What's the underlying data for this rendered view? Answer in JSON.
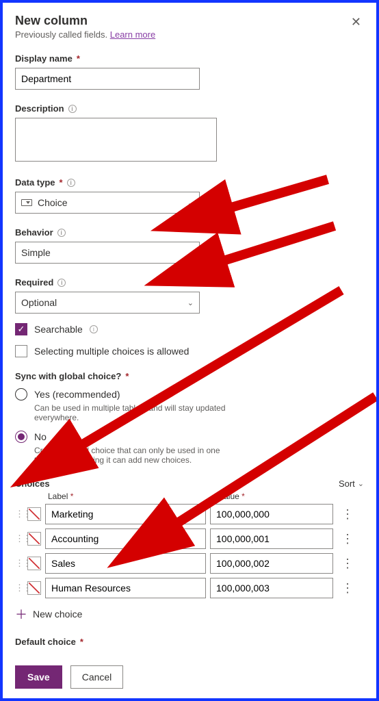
{
  "header": {
    "title": "New column",
    "subtitle_prefix": "Previously called fields. ",
    "learn_more": "Learn more"
  },
  "fields": {
    "display_name": {
      "label": "Display name",
      "value": "Department"
    },
    "description": {
      "label": "Description",
      "value": ""
    },
    "data_type": {
      "label": "Data type",
      "value": "Choice"
    },
    "behavior": {
      "label": "Behavior",
      "value": "Simple"
    },
    "required": {
      "label": "Required",
      "value": "Optional"
    }
  },
  "checkboxes": {
    "searchable_label": "Searchable",
    "searchable_checked": true,
    "multi_label": "Selecting multiple choices is allowed",
    "multi_checked": false
  },
  "sync": {
    "label": "Sync with global choice?",
    "yes_label": "Yes (recommended)",
    "yes_hint": "Can be used in multiple tables, and will stay updated everywhere.",
    "no_label": "No",
    "no_hint": "Creates a local choice that can only be used in one table. People using it can add new choices.",
    "selected": "no"
  },
  "choices_section": {
    "heading": "Choices",
    "sort_label": "Sort",
    "col_label": "Label",
    "col_value": "Value",
    "new_choice_label": "New choice",
    "rows": [
      {
        "label": "Marketing",
        "value": "100,000,000"
      },
      {
        "label": "Accounting",
        "value": "100,000,001"
      },
      {
        "label": "Sales",
        "value": "100,000,002"
      },
      {
        "label": "Human Resources",
        "value": "100,000,003"
      }
    ]
  },
  "default_choice_label": "Default choice",
  "buttons": {
    "save": "Save",
    "cancel": "Cancel"
  }
}
